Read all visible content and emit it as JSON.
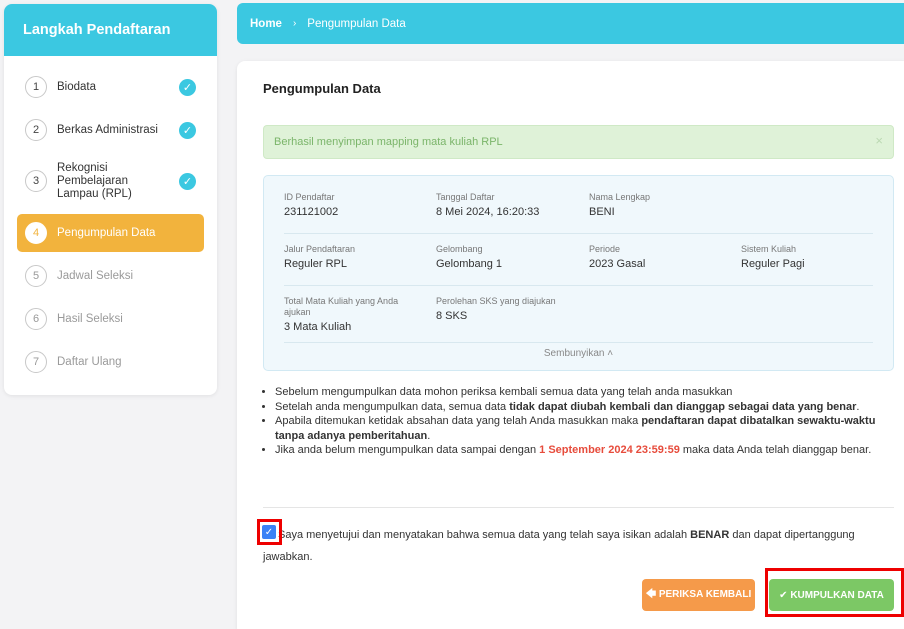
{
  "sidebar": {
    "title": "Langkah Pendaftaran",
    "steps": [
      {
        "num": "1",
        "label": "Biodata",
        "done": true
      },
      {
        "num": "2",
        "label": "Berkas Administrasi",
        "done": true
      },
      {
        "num": "3",
        "label": "Rekognisi Pembelajaran Lampau (RPL)",
        "done": true
      },
      {
        "num": "4",
        "label": "Pengumpulan Data",
        "active": true
      },
      {
        "num": "5",
        "label": "Jadwal Seleksi"
      },
      {
        "num": "6",
        "label": "Hasil Seleksi"
      },
      {
        "num": "7",
        "label": "Daftar Ulang"
      }
    ]
  },
  "breadcrumb": {
    "home": "Home",
    "separator": "›",
    "current": "Pengumpulan Data"
  },
  "page": {
    "title": "Pengumpulan Data"
  },
  "alert": {
    "text": "Berhasil menyimpan mapping mata kuliah RPL",
    "close": "×"
  },
  "info": {
    "id_label": "ID Pendaftar",
    "id_value": "231121002",
    "date_label": "Tanggal Daftar",
    "date_value": "8 Mei 2024, 16:20:33",
    "name_label": "Nama Lengkap",
    "name_value": "BENI",
    "track_label": "Jalur Pendaftaran",
    "track_value": "Reguler RPL",
    "wave_label": "Gelombang",
    "wave_value": "Gelombang 1",
    "period_label": "Periode",
    "period_value": "2023 Gasal",
    "system_label": "Sistem Kuliah",
    "system_value": "Reguler Pagi",
    "courses_label": "Total Mata Kuliah yang Anda ajukan",
    "courses_value": "3 Mata Kuliah",
    "sks_label": "Perolehan SKS yang diajukan",
    "sks_value": "8 SKS",
    "hide_label": "Sembunyikan ˄"
  },
  "notes": {
    "n1": "Sebelum mengumpulkan data mohon periksa kembali semua data yang telah anda masukkan",
    "n2a": "Setelah anda mengumpulkan data, semua data ",
    "n2b": "tidak dapat diubah kembali dan dianggap sebagai data yang benar",
    "n2c": ".",
    "n3a": "Apabila ditemukan ketidak absahan data yang telah Anda masukkan maka ",
    "n3b": "pendaftaran dapat dibatalkan sewaktu-waktu tanpa adanya pemberitahuan",
    "n3c": ".",
    "n4a": "Jika anda belum mengumpulkan data sampai dengan ",
    "n4b": "1 September 2024 23:59:59",
    "n4c": " maka data Anda telah dianggap benar."
  },
  "agree": {
    "a": "Saya menyetujui dan menyatakan bahwa semua data yang telah saya isikan adalah ",
    "b": "BENAR",
    "c": " dan dapat dipertanggung jawabkan.",
    "checked": true
  },
  "buttons": {
    "back": "🡄 PERIKSA KEMBALI",
    "submit": "✔ KUMPULKAN DATA"
  },
  "colors": {
    "accent": "#3bc8e1",
    "active_step": "#f2b33d",
    "back": "#f59a4a",
    "submit": "#7cc865",
    "highlight": "#e00000"
  }
}
